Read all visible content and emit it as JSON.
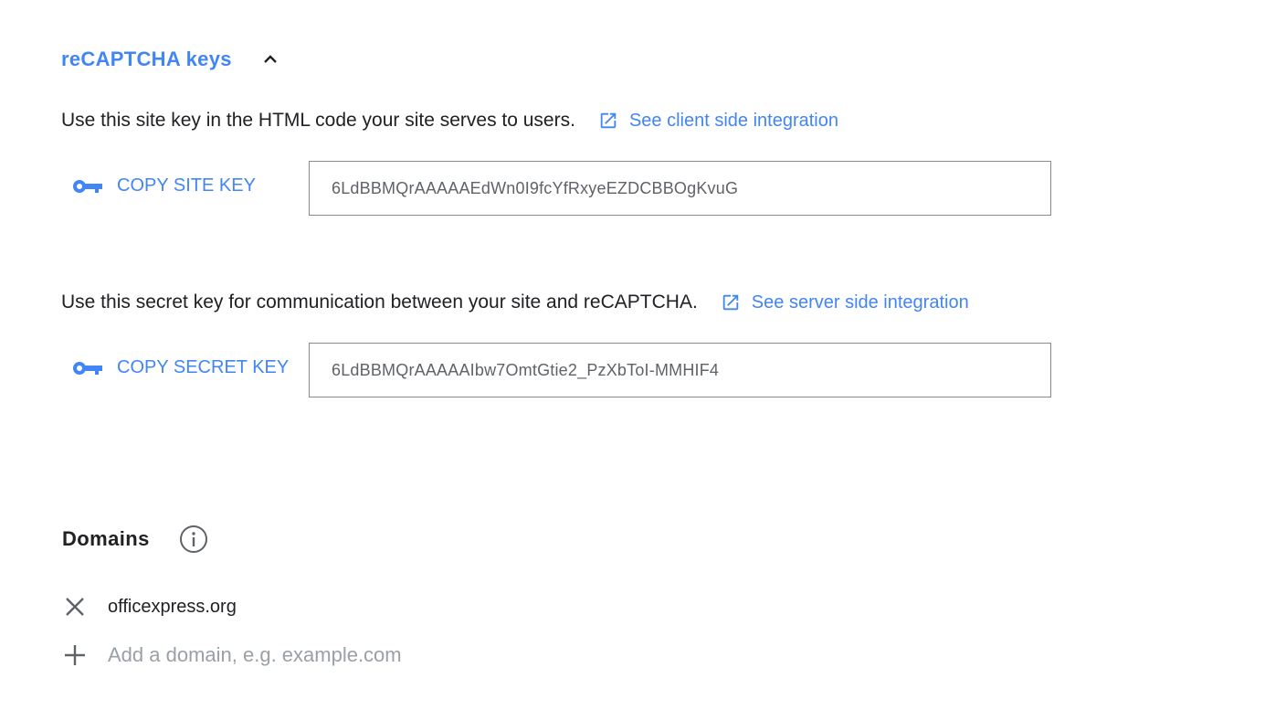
{
  "keys_section": {
    "title": "reCAPTCHA keys",
    "collapse_icon": "chevron-up-icon",
    "site_key": {
      "description": "Use this site key in the HTML code your site serves to users.",
      "link_label": "See client side integration",
      "link_icon": "open-in-new-icon",
      "copy_label": "COPY SITE KEY",
      "copy_icon": "key-icon",
      "value": "6LdBBMQrAAAAAEdWn0I9fcYfRxyeEZDCBBOgKvuG"
    },
    "secret_key": {
      "description": "Use this secret key for communication between your site and reCAPTCHA.",
      "link_label": "See server side integration",
      "link_icon": "open-in-new-icon",
      "copy_label": "COPY SECRET KEY",
      "copy_icon": "key-icon",
      "value": "6LdBBMQrAAAAAIbw7OmtGtie2_PzXbToI-MMHIF4"
    }
  },
  "domains": {
    "title": "Domains",
    "info_icon": "info-icon",
    "items": [
      {
        "name": "officexpress.org",
        "remove_icon": "close-icon"
      }
    ],
    "add": {
      "icon": "plus-icon",
      "placeholder": "Add a domain, e.g. example.com"
    }
  },
  "colors": {
    "accent": "#4285f4",
    "text": "#202124",
    "muted": "#5f6368",
    "border": "#8a8a8a"
  }
}
